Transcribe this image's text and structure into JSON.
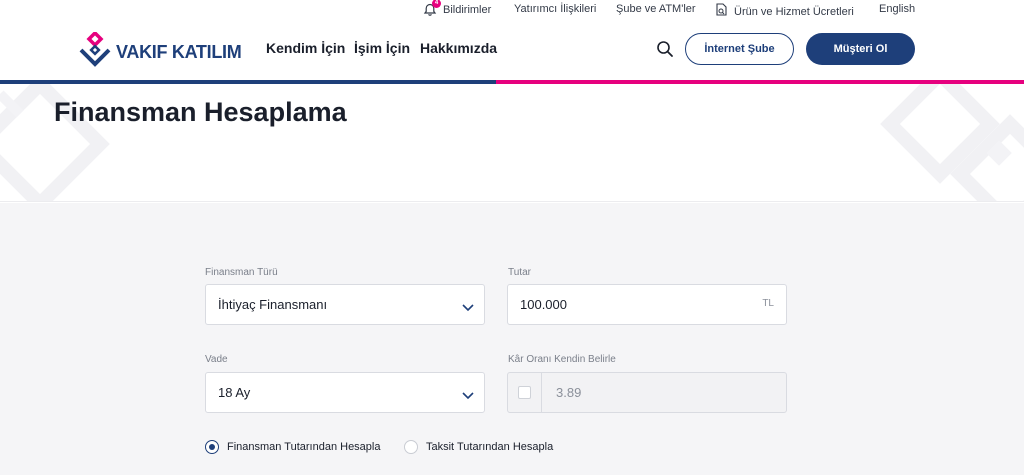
{
  "utility_bar": {
    "notifications_label": "Bildirimler",
    "notifications_badge": "4",
    "investor_relations": "Yatırımcı İlişkileri",
    "branches_atms": "Şube ve ATM'ler",
    "fees": "Ürün ve Hizmet Ücretleri",
    "language": "English"
  },
  "header": {
    "brand": "VAKIF KATILIM",
    "nav": [
      "Kendim İçin",
      "İşim İçin",
      "Hakkımızda"
    ],
    "internet_branch_label": "İnternet Şube",
    "become_customer_label": "Müşteri Ol"
  },
  "page": {
    "title": "Finansman Hesaplama"
  },
  "form": {
    "finance_type_label": "Finansman Türü",
    "finance_type_value": "İhtiyaç Finansmanı",
    "amount_label": "Tutar",
    "amount_value": "100.000",
    "amount_unit": "TL",
    "term_label": "Vade",
    "term_value": "18 Ay",
    "profit_rate_label": "Kâr Oranı Kendin Belirle",
    "profit_rate_value": "3.89",
    "calc_options": [
      {
        "label": "Finansman Tutarından Hesapla",
        "selected": true
      },
      {
        "label": "Taksit Tutarından Hesapla",
        "selected": false
      }
    ]
  },
  "colors": {
    "brand_navy": "#1e3f7a",
    "brand_pink": "#e6007e"
  }
}
